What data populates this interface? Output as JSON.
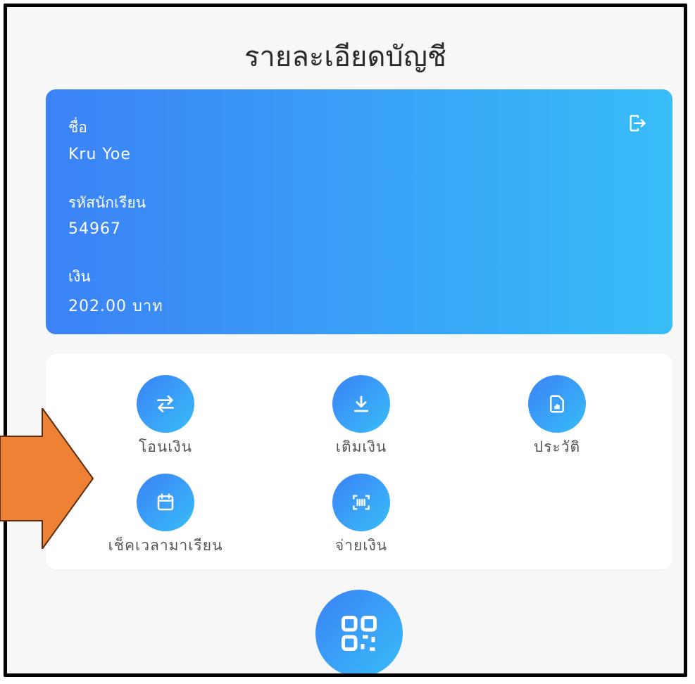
{
  "header": {
    "title": "รายละเอียดบัญชี"
  },
  "account": {
    "name_label": "ชื่อ",
    "name": "Kru Yoe",
    "id_label": "รหัสนักเรียน",
    "id": "54967",
    "balance_label": "เงิน",
    "balance": "202.00 บาท"
  },
  "menu": {
    "transfer": "โอนเงิน",
    "topup": "เติมเงิน",
    "history": "ประวัติ",
    "attendance": "เช็คเวลามาเรียน",
    "pay": "จ่ายเงิน"
  },
  "colors": {
    "accent_start": "#3b82f6",
    "accent_end": "#38bdf8",
    "callout_arrow": "#ee8133"
  }
}
